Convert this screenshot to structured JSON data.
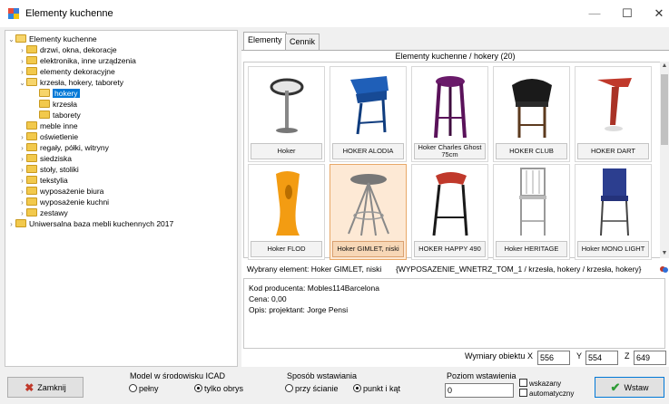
{
  "window": {
    "title": "Elementy kuchenne",
    "min": "—",
    "max": "☐",
    "close": "✕"
  },
  "tree": {
    "root": "Elementy kuchenne",
    "items": [
      "drzwi, okna, dekoracje",
      "elektronika, inne urządzenia",
      "elementy dekoracyjne",
      "krzesła, hokery, taborety",
      "hokery",
      "krzesła",
      "taborety",
      "meble inne",
      "oświetlenie",
      "regały, półki, witryny",
      "siedziska",
      "stoły, stoliki",
      "tekstylia",
      "wyposażenie biura",
      "wyposażenie kuchni",
      "zestawy"
    ],
    "second_root": "Uniwersalna baza mebli kuchennych 2017"
  },
  "tabs": [
    "Elementy",
    "Cennik"
  ],
  "gallery": {
    "title": "Elementy kuchenne / hokery (20)",
    "items": [
      "Hoker",
      "HOKER ALODIA",
      "Hoker Charles Ghost 75cm",
      "HOKER CLUB",
      "HOKER DART",
      "Hoker FLOD",
      "Hoker GIMLET, niski",
      "HOKER HAPPY 490",
      "Hoker HERITAGE",
      "Hoker MONO LIGHT"
    ],
    "selected_index": 6
  },
  "info": {
    "selected": "Wybrany element: Hoker GIMLET, niski",
    "path": "{WYPOSAZENIE_WNETRZ_TOM_1 / krzesła, hokery / krzesła, hokery}"
  },
  "details": {
    "producer": "Kod producenta: Mobles114Barcelona",
    "price": "Cena: 0,00",
    "description": "Opis: projektant: Jorge Pensi"
  },
  "dimensions": {
    "label": "Wymiary obiektu",
    "x_label": "X",
    "x": "556",
    "y_label": "Y",
    "y": "554",
    "z_label": "Z",
    "z": "649"
  },
  "bottom": {
    "close_label": "Zamknij",
    "model_group": "Model w środowisku ICAD",
    "model_options": [
      "pełny",
      "tylko obrys"
    ],
    "insert_group": "Sposób wstawiania",
    "insert_options": [
      "przy ścianie",
      "punkt i kąt"
    ],
    "level_group": "Poziom wstawienia",
    "level_value": "0",
    "level_checks": [
      "wskazany",
      "automatyczny"
    ],
    "insert_button": "Wstaw"
  }
}
